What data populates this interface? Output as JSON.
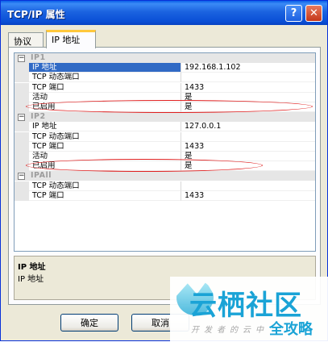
{
  "window": {
    "title": "TCP/IP 属性",
    "help_icon": "question-icon",
    "close_icon": "close-x-icon"
  },
  "tabs": [
    {
      "label": "协议",
      "active": false
    },
    {
      "label": "IP 地址",
      "active": true
    }
  ],
  "grid": {
    "categories": [
      {
        "label": "IP1",
        "toggle": "−",
        "rows": [
          {
            "name": "IP 地址",
            "value": "192.168.1.102",
            "selected": true
          },
          {
            "name": "TCP 动态端口",
            "value": ""
          },
          {
            "name": "TCP 端口",
            "value": "1433"
          },
          {
            "name": "活动",
            "value": "是"
          },
          {
            "name": "已启用",
            "value": "是"
          }
        ]
      },
      {
        "label": "IP2",
        "toggle": "−",
        "rows": [
          {
            "name": "IP 地址",
            "value": "127.0.0.1"
          },
          {
            "name": "TCP 动态端口",
            "value": ""
          },
          {
            "name": "TCP 端口",
            "value": "1433"
          },
          {
            "name": "活动",
            "value": "是"
          },
          {
            "name": "已启用",
            "value": "是"
          }
        ]
      },
      {
        "label": "IPAll",
        "toggle": "−",
        "rows": [
          {
            "name": "TCP 动态端口",
            "value": ""
          },
          {
            "name": "TCP 端口",
            "value": "1433"
          }
        ]
      }
    ]
  },
  "description": {
    "title": "IP 地址",
    "text": "IP 地址"
  },
  "buttons": {
    "ok": "确定",
    "cancel": "取消"
  },
  "watermark": {
    "title": "云栖社区",
    "subtitle": "开发者的云中",
    "badge": "全攻略"
  },
  "colors": {
    "selection": "#316ac5",
    "highlight_oval": "#e02020",
    "watermark": "#1aa3d6"
  }
}
